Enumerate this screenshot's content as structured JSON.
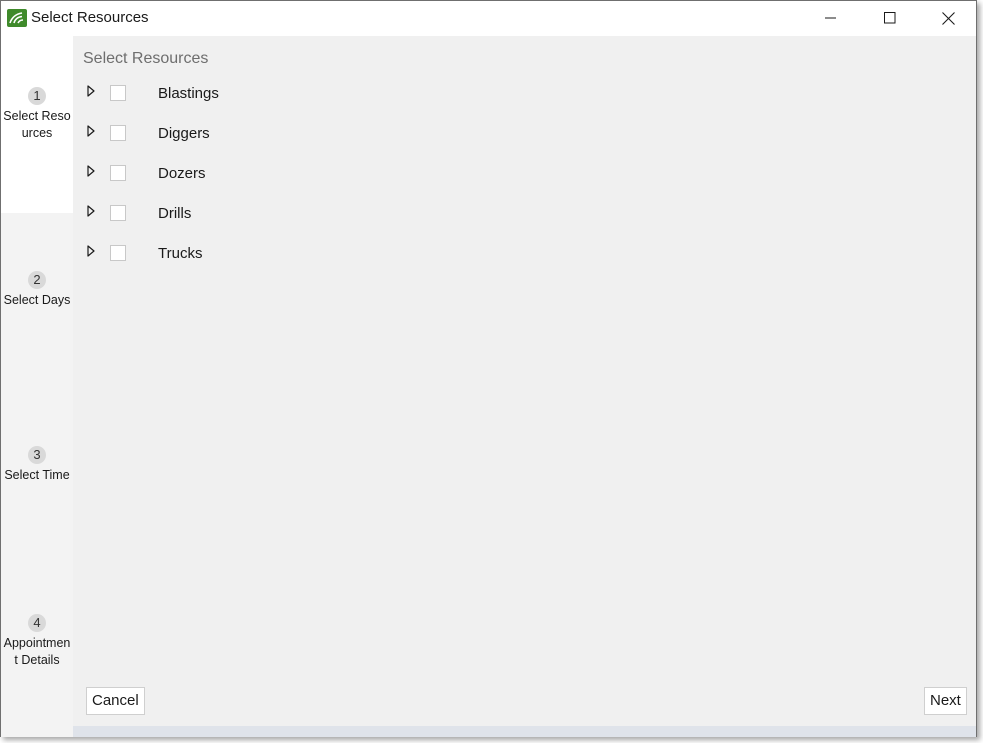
{
  "window": {
    "title": "Select Resources",
    "icons": {
      "app": "app-logo-icon",
      "minimize": "minimize-icon",
      "maximize": "maximize-icon",
      "close": "close-icon"
    }
  },
  "steps": [
    {
      "number": "1",
      "label": "Select Resources",
      "active": true
    },
    {
      "number": "2",
      "label": "Select Days",
      "active": false
    },
    {
      "number": "3",
      "label": "Select Time",
      "active": false
    },
    {
      "number": "4",
      "label": "Appointment Details",
      "active": false
    }
  ],
  "main": {
    "section_title": "Select Resources",
    "resources": [
      {
        "label": "Blastings",
        "checked": false,
        "expanded": false
      },
      {
        "label": "Diggers",
        "checked": false,
        "expanded": false
      },
      {
        "label": "Dozers",
        "checked": false,
        "expanded": false
      },
      {
        "label": "Drills",
        "checked": false,
        "expanded": false
      },
      {
        "label": "Trucks",
        "checked": false,
        "expanded": false
      }
    ]
  },
  "footer": {
    "cancel_label": "Cancel",
    "next_label": "Next"
  },
  "colors": {
    "brand": "#3f8a2b",
    "content_background": "#f0f0f0",
    "sidebar_background": "#f3f3f3",
    "step_badge": "#d9d9d9"
  }
}
